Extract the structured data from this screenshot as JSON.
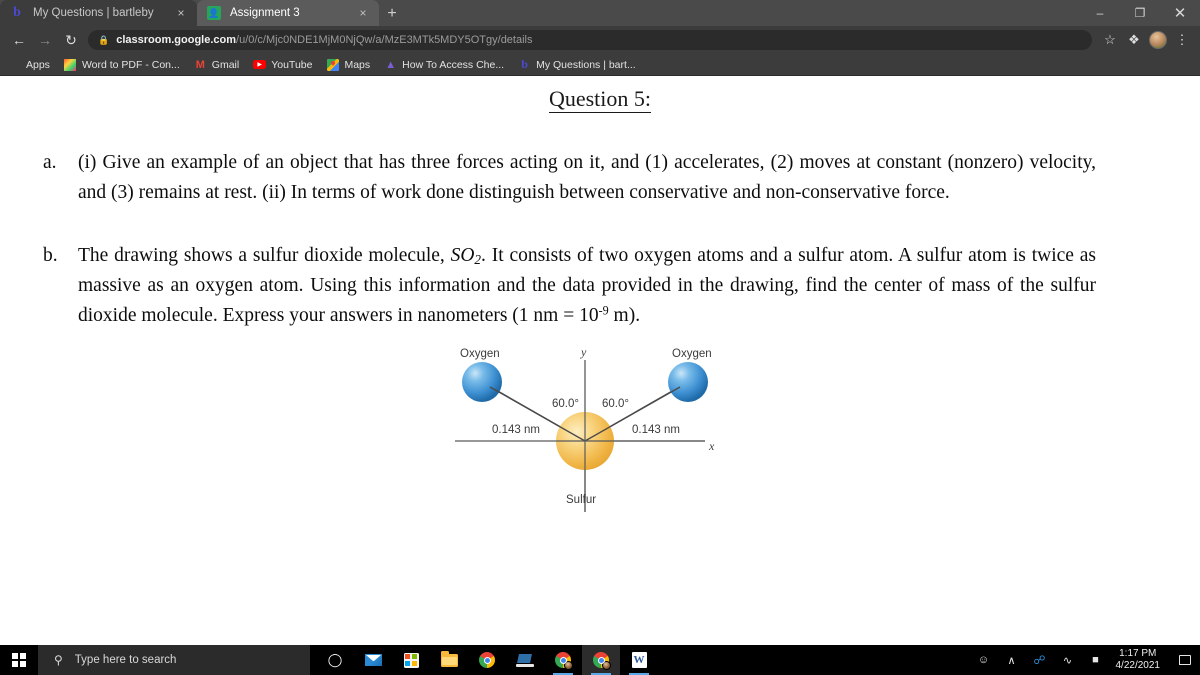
{
  "browser": {
    "tabs": [
      {
        "title": "My Questions | bartleby",
        "favicon": "bartleby-b-icon",
        "active": false,
        "close_label": "×"
      },
      {
        "title": "Assignment 3",
        "favicon": "google-classroom-icon",
        "active": true,
        "close_label": "×"
      }
    ],
    "new_tab_label": "+",
    "window_controls": {
      "minimize": "–",
      "maximize": "❐",
      "close": "✕"
    },
    "nav": {
      "back": "←",
      "forward": "→",
      "reload": "↻"
    },
    "omnibox": {
      "lock_icon": "lock-icon",
      "host": "classroom.google.com",
      "path": "/u/0/c/Mjc0NDE1MjM0NjQw/a/MzE3MTk5MDY5OTgy/details"
    },
    "toolbar_icons": {
      "bookmark_star": "☆",
      "extensions": "❖",
      "menu": "⋮"
    },
    "bookmarks": [
      {
        "label": "Apps",
        "icon": "apps-grid-icon"
      },
      {
        "label": "Word to PDF - Con...",
        "icon": "word-to-pdf-icon"
      },
      {
        "label": "Gmail",
        "icon": "gmail-icon"
      },
      {
        "label": "YouTube",
        "icon": "youtube-icon"
      },
      {
        "label": "Maps",
        "icon": "google-maps-icon"
      },
      {
        "label": "How To Access Che...",
        "icon": "chemistry-icon"
      },
      {
        "label": "My Questions | bart...",
        "icon": "bartleby-b-icon"
      }
    ]
  },
  "page": {
    "title": "Question 5:",
    "items": [
      {
        "marker": "a.",
        "text": "(i) Give an example of an object that has three forces acting on it, and (1) accelerates, (2) moves at constant (nonzero) velocity, and (3) remains at rest. (ii) In terms of work done distinguish between conservative and non-conservative force."
      },
      {
        "marker": "b.",
        "text_part1": "The drawing shows a sulfur dioxide molecule, ",
        "formula": "SO",
        "formula_sub": "2",
        "text_part2": ". It consists of two oxygen atoms and a sulfur atom. A sulfur atom is twice as massive as an oxygen atom. Using this information and the data provided in the drawing, find the center of mass of the sulfur dioxide molecule. Express your answers in nanometers (1 nm = 10",
        "exponent": "-9",
        "text_part3": " m)."
      }
    ],
    "figure": {
      "label_oxygen_left": "Oxygen",
      "label_oxygen_right": "Oxygen",
      "label_sulfur": "Sulfur",
      "angle_left": "60.0°",
      "angle_right": "60.0°",
      "distance_left": "0.143 nm",
      "distance_right": "0.143 nm",
      "axis_x": "x",
      "axis_y": "y",
      "colors": {
        "oxygen": "#3d8fd1",
        "oxygen_highlight": "#a8d4f0",
        "sulfur": "#f0b545",
        "sulfur_highlight": "#fde3a8",
        "bond_line": "#4a4a4a",
        "axis_line": "#4a4a4a"
      }
    }
  },
  "taskbar": {
    "start_label": "start-button",
    "search_placeholder": "Type here to search",
    "search_icon": "search-icon",
    "apps": [
      {
        "name": "task-view",
        "icon": "task-view-icon",
        "running": false,
        "active": false
      },
      {
        "name": "mail",
        "icon": "mail-icon",
        "running": false,
        "active": false
      },
      {
        "name": "microsoft-store",
        "icon": "store-icon",
        "running": false,
        "active": false
      },
      {
        "name": "file-explorer",
        "icon": "folder-icon",
        "running": false,
        "active": false
      },
      {
        "name": "google-chrome",
        "icon": "chrome-icon",
        "running": false,
        "active": false
      },
      {
        "name": "remote-desktop",
        "icon": "laptop-icon",
        "running": false,
        "active": false
      },
      {
        "name": "chrome-window-1",
        "icon": "chrome-profile-icon",
        "running": true,
        "active": false
      },
      {
        "name": "chrome-window-2",
        "icon": "chrome-profile-icon",
        "running": true,
        "active": true
      },
      {
        "name": "microsoft-word",
        "icon": "word-icon",
        "running": true,
        "active": false
      }
    ],
    "tray": {
      "people_icon": "people-icon",
      "chevron_up": "∧",
      "bluetooth_icon": "bluetooth-icon",
      "wifi_icon": "wifi-icon",
      "battery_icon": "battery-icon",
      "time": "1:17 PM",
      "date": "4/22/2021",
      "notifications_icon": "notifications-icon"
    }
  }
}
